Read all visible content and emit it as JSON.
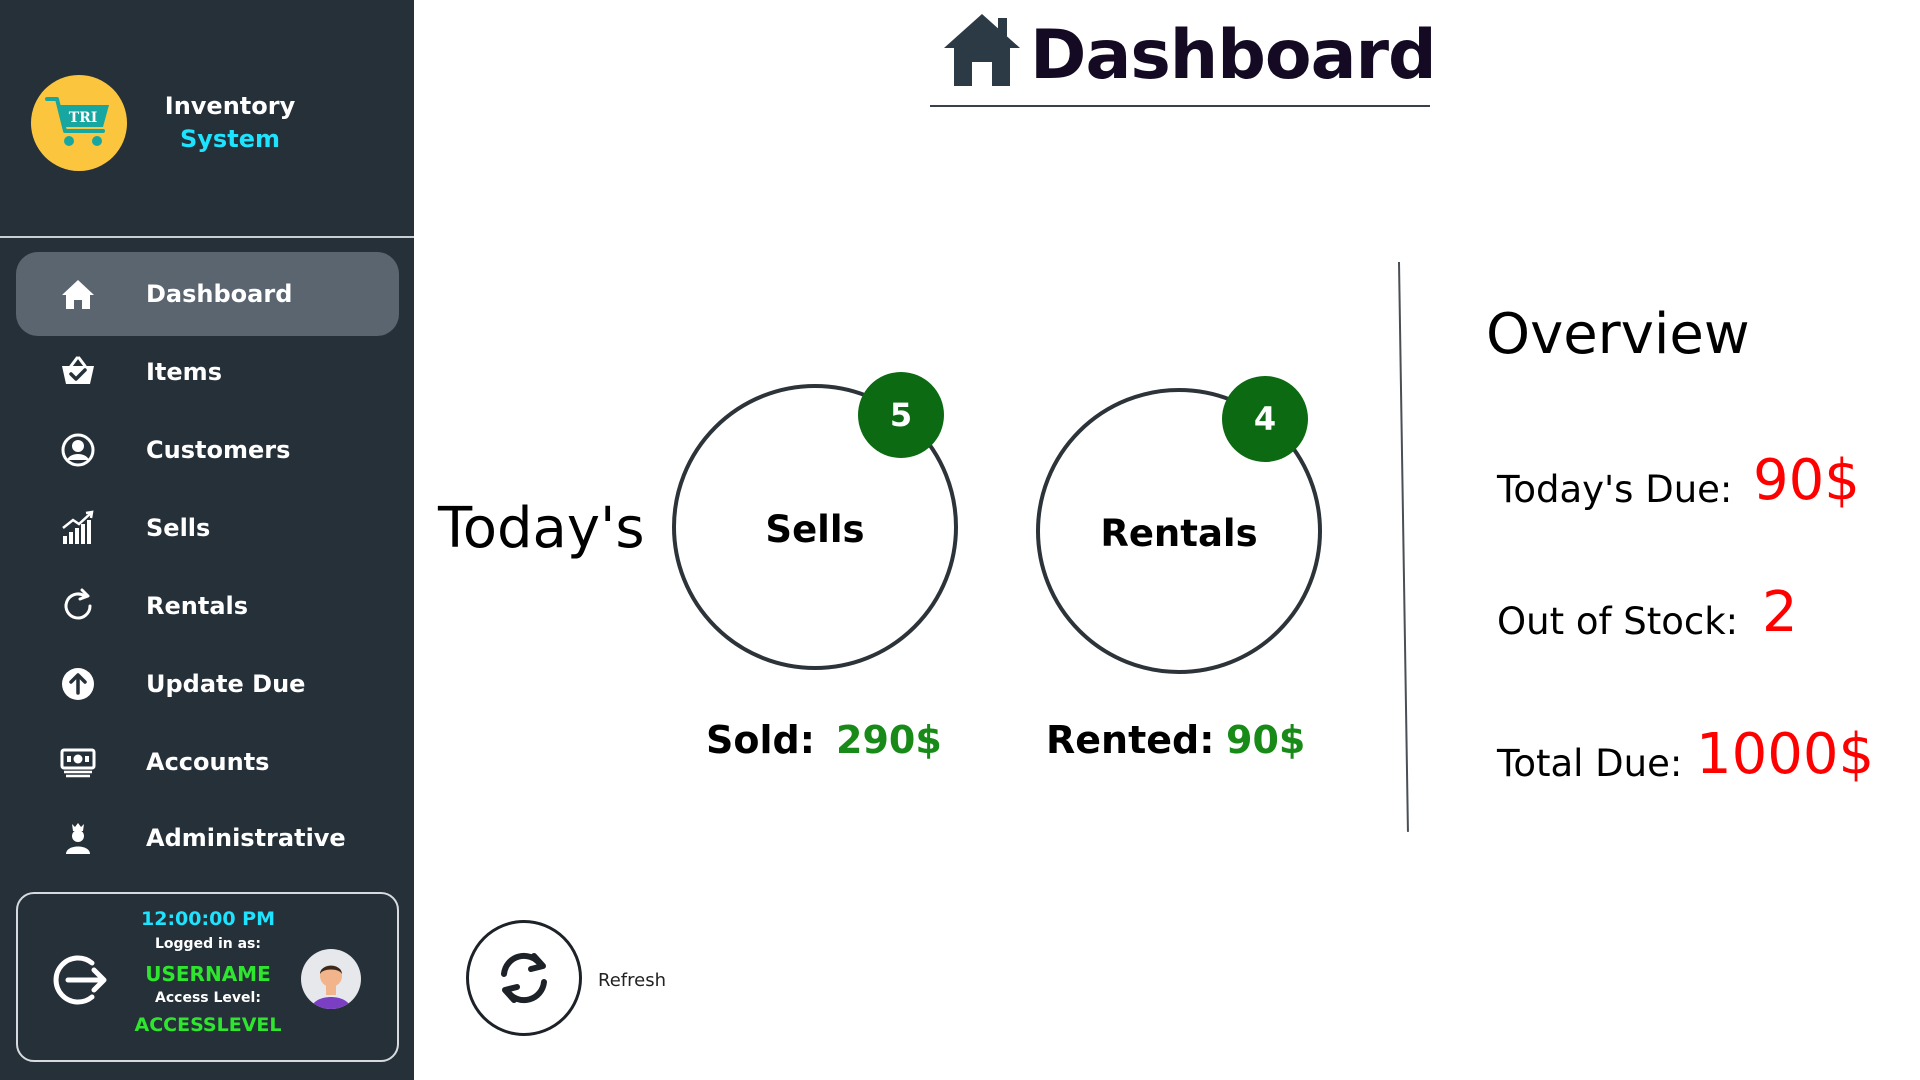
{
  "brand": {
    "logo_text": "TRI",
    "line1": "Inventory",
    "line2": "System"
  },
  "sidebar": {
    "items": [
      {
        "label": "Dashboard",
        "icon": "home-icon",
        "active": true
      },
      {
        "label": "Items",
        "icon": "basket-icon"
      },
      {
        "label": "Customers",
        "icon": "user-circle-icon"
      },
      {
        "label": "Sells",
        "icon": "chart-bars-icon"
      },
      {
        "label": "Rentals",
        "icon": "rotate-icon"
      },
      {
        "label": "Update Due",
        "icon": "arrow-up-circle-icon"
      },
      {
        "label": "Accounts",
        "icon": "money-icon"
      },
      {
        "label": "Administrative",
        "icon": "admin-icon"
      }
    ]
  },
  "status": {
    "time": "12:00:00 PM",
    "logged_in_label": "Logged in as:",
    "username": "USERNAME",
    "access_label": "Access Level:",
    "access_level": "ACCESSLEVEL"
  },
  "header": {
    "title": "Dashboard"
  },
  "today": {
    "heading": "Today's",
    "sells": {
      "label": "Sells",
      "count": "5",
      "sub_label": "Sold:",
      "sub_value": "290$"
    },
    "rentals": {
      "label": "Rentals",
      "count": "4",
      "sub_label": "Rented:",
      "sub_value": "90$"
    }
  },
  "overview": {
    "title": "Overview",
    "rows": [
      {
        "label": "Today's Due:",
        "value": "90$"
      },
      {
        "label": "Out of Stock:",
        "value": "2"
      },
      {
        "label": "Total Due:",
        "value": "1000$"
      }
    ]
  },
  "refresh": {
    "label": "Refresh"
  },
  "colors": {
    "sidebar_bg": "#263039",
    "active_item_bg": "#5b6570",
    "accent_cyan": "#1ee3ff",
    "accent_green": "#2ee62e",
    "badge_green": "#0b6a12",
    "value_green": "#178a17",
    "overview_red": "#ff0000"
  }
}
